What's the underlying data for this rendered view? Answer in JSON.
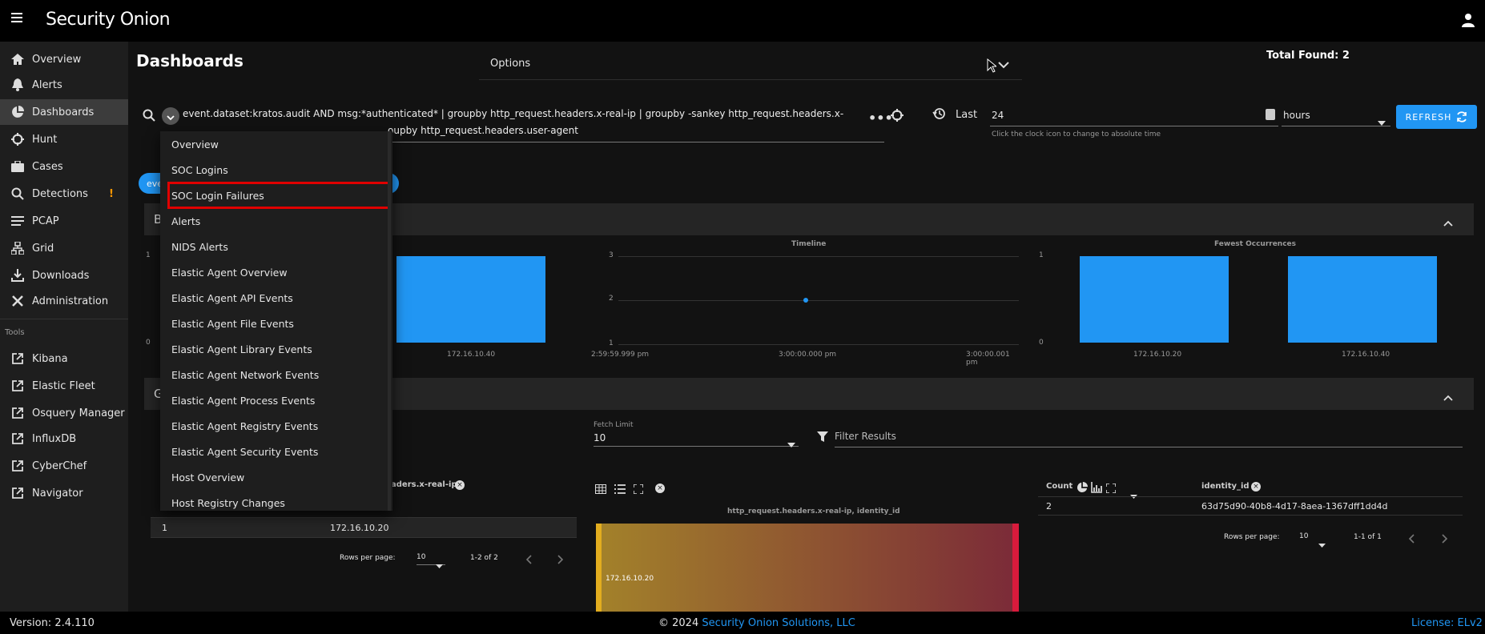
{
  "header": {
    "logo_text": "Security Onion"
  },
  "sidebar": {
    "items": [
      {
        "label": "Overview"
      },
      {
        "label": "Alerts"
      },
      {
        "label": "Dashboards"
      },
      {
        "label": "Hunt"
      },
      {
        "label": "Cases"
      },
      {
        "label": "Detections",
        "badge": "!"
      },
      {
        "label": "PCAP"
      },
      {
        "label": "Grid"
      },
      {
        "label": "Downloads"
      },
      {
        "label": "Administration"
      }
    ],
    "tools_header": "Tools",
    "tools": [
      {
        "label": "Kibana"
      },
      {
        "label": "Elastic Fleet"
      },
      {
        "label": "Osquery Manager"
      },
      {
        "label": "InfluxDB"
      },
      {
        "label": "CyberChef"
      },
      {
        "label": "Navigator"
      }
    ]
  },
  "page": {
    "title": "Dashboards",
    "options_label": "Options",
    "total_found": "Total Found: 2"
  },
  "query": {
    "line1": "event.dataset:kratos.audit AND msg:*authenticated* | groupby http_request.headers.x-real-ip | groupby -sankey http_request.headers.x-",
    "line2": "oupby http_request.headers.user-agent",
    "chip_left": "eve"
  },
  "time": {
    "mode_label": "Last",
    "value": "24",
    "unit": "hours",
    "hint": "Click the clock icon to change to absolute time",
    "refresh_label": "REFRESH"
  },
  "dropdown": {
    "items": [
      "Overview",
      "SOC Logins",
      "SOC Login Failures",
      "Alerts",
      "NIDS Alerts",
      "Elastic Agent Overview",
      "Elastic Agent API Events",
      "Elastic Agent File Events",
      "Elastic Agent Library Events",
      "Elastic Agent Network Events",
      "Elastic Agent Process Events",
      "Elastic Agent Registry Events",
      "Elastic Agent Security Events",
      "Host Overview",
      "Host Registry Changes"
    ],
    "highlighted": "SOC Login Failures"
  },
  "section1": {
    "letter": "B"
  },
  "section2": {
    "letter": "G"
  },
  "chart_data": [
    {
      "type": "bar",
      "title": "",
      "categories": [
        "172.16.10.40"
      ],
      "values": [
        1
      ],
      "ylim": [
        0,
        1
      ],
      "yticks": [
        "1",
        "0"
      ]
    },
    {
      "type": "line",
      "title": "Timeline",
      "x": [
        "2:59:59.999 pm",
        "3:00:00.000 pm",
        "3:00:00.001 pm"
      ],
      "points": [
        {
          "x": "3:00:00.000 pm",
          "y": 2
        }
      ],
      "ylim": [
        1,
        3
      ],
      "yticks": [
        "3",
        "2",
        "1"
      ]
    },
    {
      "type": "bar",
      "title": "Fewest Occurrences",
      "categories": [
        "172.16.10.20",
        "172.16.10.40"
      ],
      "values": [
        1,
        1
      ],
      "ylim": [
        0,
        1
      ],
      "yticks": [
        "1",
        "0"
      ]
    }
  ],
  "fetch": {
    "label": "Fetch Limit",
    "value": "10",
    "filter_placeholder": "Filter Results"
  },
  "table_left": {
    "column": "aders.x-real-ip",
    "rows": [
      {
        "count": "1",
        "value": "172.16.10.20"
      }
    ],
    "rows_per_page_label": "Rows per page:",
    "rows_per_page": "10",
    "range": "1-2 of 2"
  },
  "sankey": {
    "title": "http_request.headers.x-real-ip, identity_id",
    "node_label": "172.16.10.20"
  },
  "table_right": {
    "count_header": "Count",
    "column": "identity_id",
    "rows": [
      {
        "count": "2",
        "value": "63d75d90-40b8-4d17-8aea-1367dff1dd4d"
      }
    ],
    "rows_per_page_label": "Rows per page:",
    "rows_per_page": "10",
    "range": "1-1 of 1"
  },
  "footer": {
    "version": "Version: 2.4.110",
    "copyright_prefix": "© 2024 ",
    "copyright_link": "Security Onion Solutions, LLC",
    "license": "License: ELv2"
  },
  "colors": {
    "accent": "#2196f3",
    "highlight_border": "#e00000",
    "badge": "#ff9800"
  }
}
